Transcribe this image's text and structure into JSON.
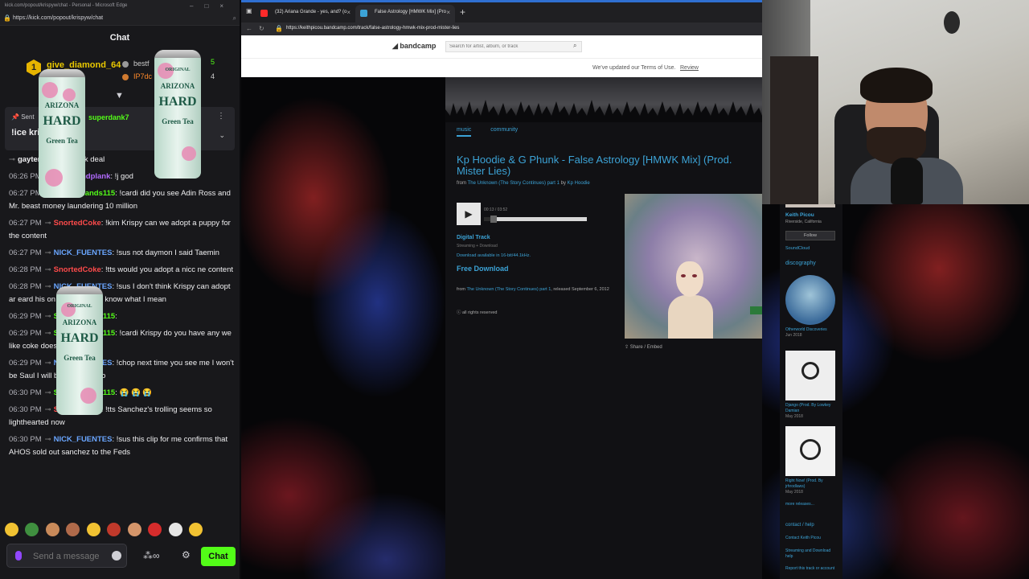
{
  "chat_window": {
    "title": "kick.com/popout/krispyw/chat - Personal - Microsoft Edge",
    "url": "https://kick.com/popout/krispyw/chat",
    "header": "Chat",
    "leaderboard": {
      "first": {
        "rank": "1",
        "name": "give_diamond_64"
      },
      "second": {
        "name": "bestf",
        "score": "5"
      },
      "third": {
        "name": "IP7dc",
        "score": "4"
      }
    },
    "pinned": {
      "label": "Sent",
      "user": "superdank7",
      "message": "!ice kri"
    },
    "messages": [
      {
        "time": "",
        "user": "gaytent",
        "color": "#efeff1",
        "text": "for that kick deal"
      },
      {
        "time": "06:26 PM",
        "user": "bestfriendplank",
        "color": "#b26bff",
        "text": "!j          god"
      },
      {
        "time": "06:27 PM",
        "user": "Sticky_hands115",
        "color": "#53fc18",
        "text": "!cardi did you see Adin Ross and Mr. beast money laundering 10 million"
      },
      {
        "time": "06:27 PM",
        "user": "SnortedCoke",
        "color": "#ff4b4b",
        "text": "!kim Krispy can we adopt a puppy for the content"
      },
      {
        "time": "06:27 PM",
        "user": "NICK_FUENTES",
        "color": "#6aa6ff",
        "text": "!sus not daymon I said Taemin"
      },
      {
        "time": "06:28 PM",
        "user": "SnortedCoke",
        "color": "#ff4b4b",
        "text": "!tts would you adopt a nicc        ne content"
      },
      {
        "time": "06:28 PM",
        "user": "NICK_FUENTES",
        "color": "#6aa6ff",
        "text": "!sus I don't think Krispy can adopt ar       eard his on the list of you know what I mean"
      },
      {
        "time": "06:29 PM",
        "user": "Sticky_hands115",
        "color": "#53fc18",
        "text": ""
      },
      {
        "time": "06:29 PM",
        "user": "Sticky_hands115",
        "color": "#53fc18",
        "text": "!cardi Krispy do you have any we       like coke does?"
      },
      {
        "time": "06:29 PM",
        "user": "NICK_FUENTES",
        "color": "#6aa6ff",
        "text": "!chop next time you see me I won't be Saul I will be saula ayooo"
      },
      {
        "time": "06:30 PM",
        "user": "Sticky_hands115",
        "color": "#53fc18",
        "text": "😭 😭 😭"
      },
      {
        "time": "06:30 PM",
        "user": "SnortedCoke",
        "color": "#ff4b4b",
        "text": "!tts Sanchez's trolling seems so lighthearted now"
      },
      {
        "time": "06:30 PM",
        "user": "NICK_FUENTES",
        "color": "#6aa6ff",
        "text": "!sus this clip for me confirms that AHOS sold out sanchez to the Feds"
      }
    ],
    "input_placeholder": "Send a message",
    "chat_button": "Chat",
    "can_text": {
      "brand": "ARIZONA",
      "line1": "HARD",
      "line2": "Green Tea",
      "top": "ORIGINAL"
    }
  },
  "browser": {
    "tabs": [
      {
        "label": "(32) Ariana Grande - yes, and? (o",
        "fav_color": "#ff2a2a"
      },
      {
        "label": "False Astrology [HMWK Mix] (Pro",
        "fav_color": "#3ca3d6"
      }
    ],
    "url": "https://keithpicou.bandcamp.com/track/false-astrology-hmwk-mix-prod-mister-lies",
    "bandcamp": {
      "logo": "bandcamp",
      "search_placeholder": "Search for artist, album, or track",
      "terms_text": "We've updated our Terms of Use.",
      "terms_link": "Review",
      "nav": [
        "music",
        "community"
      ],
      "track_title": "Kp Hoodie & G Phunk - False Astrology [HMWK Mix] (Prod. Mister Lies)",
      "from_prefix": "from",
      "from_album": "The Unknown (The Story Continues) part 1",
      "from_by": "by",
      "from_artist": "Kp Hoodie",
      "player": {
        "time": "00:13 / 03:52",
        "progress": 0.06
      },
      "digital_track": "Digital Track",
      "streaming": "Streaming + Download",
      "download_quality": "Download available in 16-bit/44.1kHz.",
      "free_download": "Free Download",
      "release_prefix": "from",
      "release_album": "The Unknown (The Story Continues) part 1",
      "release_text": ", released September 6, 2012",
      "rights": "all rights reserved",
      "share": "Share / Embed",
      "artist_name": "Keith Picou",
      "artist_location": "Riverside, California",
      "follow": "Follow",
      "soundcloud": "SoundCloud",
      "discography": "discography",
      "releases": [
        {
          "title": "Otherworld Discoveries",
          "date": "Jun 2018",
          "color": "#3a6a9a"
        },
        {
          "title": "Django (Prod. By Lowkey Damian",
          "date": "May 2018",
          "color": "#eeeeee"
        },
        {
          "title": "Right Now! (Prod. By jrhrodlaws)",
          "date": "May 2018",
          "color": "#f2f2f2"
        }
      ],
      "more_releases": "more releases...",
      "contact_help": "contact / help",
      "contact_link": "Contact Keith Picou",
      "streaming_help": "Streaming and Download help",
      "report": "Report this track or account"
    }
  }
}
